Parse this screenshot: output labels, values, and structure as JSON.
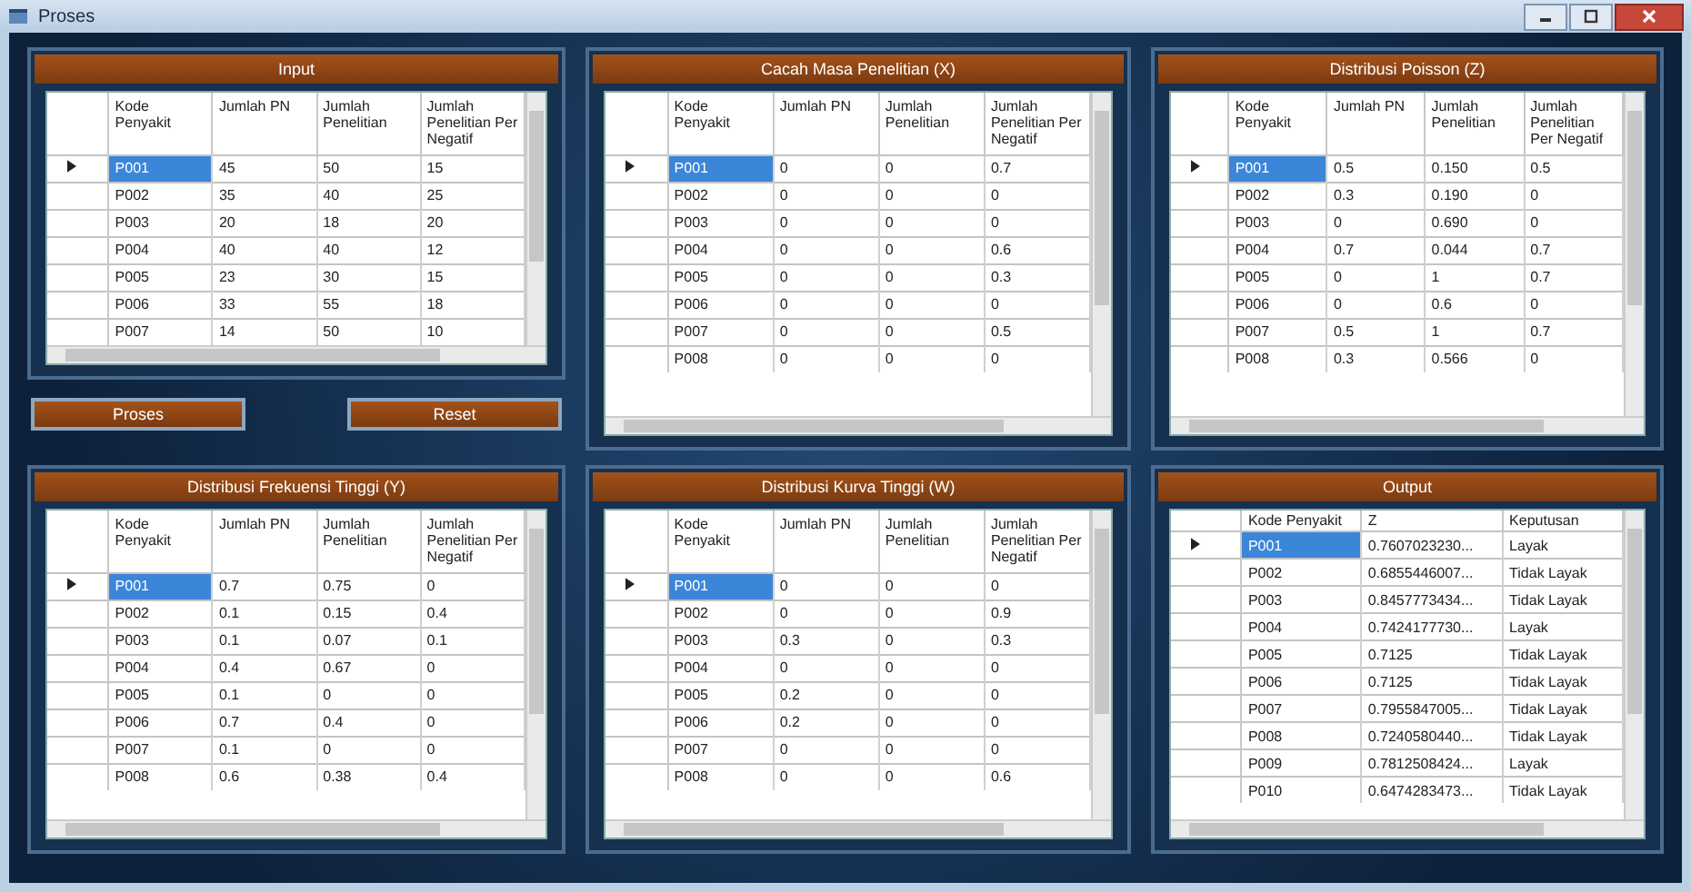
{
  "window": {
    "title": "Proses"
  },
  "panels": [
    {
      "title": "Input",
      "columns": [
        "Kode Penyakit",
        "Jumlah PN",
        "Jumlah Penelitian",
        "Jumlah Penelitian Per Negatif"
      ],
      "rows": [
        {
          "selected": true,
          "cells": [
            "P001",
            "45",
            "50",
            "15"
          ]
        },
        {
          "selected": false,
          "cells": [
            "P002",
            "35",
            "40",
            "25"
          ]
        },
        {
          "selected": false,
          "cells": [
            "P003",
            "20",
            "18",
            "20"
          ]
        },
        {
          "selected": false,
          "cells": [
            "P004",
            "40",
            "40",
            "12"
          ]
        },
        {
          "selected": false,
          "cells": [
            "P005",
            "23",
            "30",
            "15"
          ]
        },
        {
          "selected": false,
          "cells": [
            "P006",
            "33",
            "55",
            "18"
          ]
        },
        {
          "selected": false,
          "cells": [
            "P007",
            "14",
            "50",
            "10"
          ]
        }
      ]
    },
    {
      "title": "Cacah Masa Penelitian (X)",
      "columns": [
        "Kode Penyakit",
        "Jumlah PN",
        "Jumlah Penelitian",
        "Jumlah Penelitian Per Negatif"
      ],
      "rows": [
        {
          "selected": true,
          "cells": [
            "P001",
            "0",
            "0",
            "0.7"
          ]
        },
        {
          "selected": false,
          "cells": [
            "P002",
            "0",
            "0",
            "0"
          ]
        },
        {
          "selected": false,
          "cells": [
            "P003",
            "0",
            "0",
            "0"
          ]
        },
        {
          "selected": false,
          "cells": [
            "P004",
            "0",
            "0",
            "0.6"
          ]
        },
        {
          "selected": false,
          "cells": [
            "P005",
            "0",
            "0",
            "0.3"
          ]
        },
        {
          "selected": false,
          "cells": [
            "P006",
            "0",
            "0",
            "0"
          ]
        },
        {
          "selected": false,
          "cells": [
            "P007",
            "0",
            "0",
            "0.5"
          ]
        },
        {
          "selected": false,
          "cells": [
            "P008",
            "0",
            "0",
            "0"
          ]
        }
      ]
    },
    {
      "title": "Distribusi Poisson (Z)",
      "columns": [
        "Kode Penyakit",
        "Jumlah PN",
        "Jumlah Penelitian",
        "Jumlah Penelitian Per Negatif"
      ],
      "rows": [
        {
          "selected": true,
          "cells": [
            "P001",
            "0.5",
            "0.150",
            "0.5"
          ]
        },
        {
          "selected": false,
          "cells": [
            "P002",
            "0.3",
            "0.190",
            "0"
          ]
        },
        {
          "selected": false,
          "cells": [
            "P003",
            "0",
            "0.690",
            "0"
          ]
        },
        {
          "selected": false,
          "cells": [
            "P004",
            "0.7",
            "0.044",
            "0.7"
          ]
        },
        {
          "selected": false,
          "cells": [
            "P005",
            "0",
            "1",
            "0.7"
          ]
        },
        {
          "selected": false,
          "cells": [
            "P006",
            "0",
            "0.6",
            "0"
          ]
        },
        {
          "selected": false,
          "cells": [
            "P007",
            "0.5",
            "1",
            "0.7"
          ]
        },
        {
          "selected": false,
          "cells": [
            "P008",
            "0.3",
            "0.566",
            "0"
          ]
        }
      ]
    },
    {
      "title": "Distribusi Frekuensi Tinggi (Y)",
      "columns": [
        "Kode Penyakit",
        "Jumlah PN",
        "Jumlah Penelitian",
        "Jumlah Penelitian Per Negatif"
      ],
      "rows": [
        {
          "selected": true,
          "cells": [
            "P001",
            "0.7",
            "0.75",
            "0"
          ]
        },
        {
          "selected": false,
          "cells": [
            "P002",
            "0.1",
            "0.15",
            "0.4"
          ]
        },
        {
          "selected": false,
          "cells": [
            "P003",
            "0.1",
            "0.07",
            "0.1"
          ]
        },
        {
          "selected": false,
          "cells": [
            "P004",
            "0.4",
            "0.67",
            "0"
          ]
        },
        {
          "selected": false,
          "cells": [
            "P005",
            "0.1",
            "0",
            "0"
          ]
        },
        {
          "selected": false,
          "cells": [
            "P006",
            "0.7",
            "0.4",
            "0"
          ]
        },
        {
          "selected": false,
          "cells": [
            "P007",
            "0.1",
            "0",
            "0"
          ]
        },
        {
          "selected": false,
          "cells": [
            "P008",
            "0.6",
            "0.38",
            "0.4"
          ]
        }
      ]
    },
    {
      "title": "Distribusi Kurva Tinggi (W)",
      "columns": [
        "Kode Penyakit",
        "Jumlah PN",
        "Jumlah Penelitian",
        "Jumlah Penelitian Per Negatif"
      ],
      "rows": [
        {
          "selected": true,
          "cells": [
            "P001",
            "0",
            "0",
            "0"
          ]
        },
        {
          "selected": false,
          "cells": [
            "P002",
            "0",
            "0",
            "0.9"
          ]
        },
        {
          "selected": false,
          "cells": [
            "P003",
            "0.3",
            "0",
            "0.3"
          ]
        },
        {
          "selected": false,
          "cells": [
            "P004",
            "0",
            "0",
            "0"
          ]
        },
        {
          "selected": false,
          "cells": [
            "P005",
            "0.2",
            "0",
            "0"
          ]
        },
        {
          "selected": false,
          "cells": [
            "P006",
            "0.2",
            "0",
            "0"
          ]
        },
        {
          "selected": false,
          "cells": [
            "P007",
            "0",
            "0",
            "0"
          ]
        },
        {
          "selected": false,
          "cells": [
            "P008",
            "0",
            "0",
            "0.6"
          ]
        }
      ]
    },
    {
      "title": "Output",
      "columns": [
        "Kode Penyakit",
        "Z",
        "Keputusan"
      ],
      "rows": [
        {
          "selected": true,
          "cells": [
            "P001",
            "0.7607023230...",
            "Layak"
          ]
        },
        {
          "selected": false,
          "cells": [
            "P002",
            "0.6855446007...",
            "Tidak Layak"
          ]
        },
        {
          "selected": false,
          "cells": [
            "P003",
            "0.8457773434...",
            "Tidak Layak"
          ]
        },
        {
          "selected": false,
          "cells": [
            "P004",
            "0.7424177730...",
            "Layak"
          ]
        },
        {
          "selected": false,
          "cells": [
            "P005",
            "0.7125",
            "Tidak Layak"
          ]
        },
        {
          "selected": false,
          "cells": [
            "P006",
            "0.7125",
            "Tidak Layak"
          ]
        },
        {
          "selected": false,
          "cells": [
            "P007",
            "0.7955847005...",
            "Tidak Layak"
          ]
        },
        {
          "selected": false,
          "cells": [
            "P008",
            "0.7240580440...",
            "Tidak Layak"
          ]
        },
        {
          "selected": false,
          "cells": [
            "P009",
            "0.7812508424...",
            "Layak"
          ]
        },
        {
          "selected": false,
          "cells": [
            "P010",
            "0.6474283473...",
            "Tidak Layak"
          ]
        }
      ]
    }
  ],
  "buttons": [
    "Proses",
    "Reset"
  ]
}
